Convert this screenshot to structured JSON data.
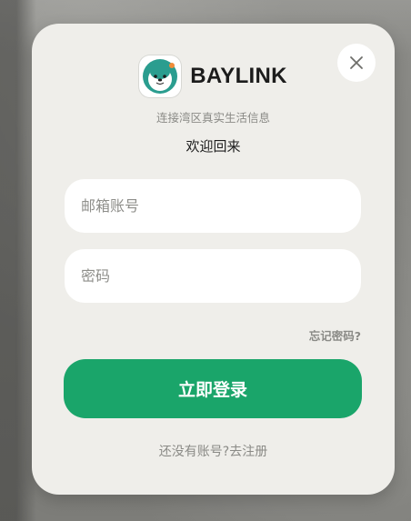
{
  "brand": {
    "name": "BAYLINK",
    "logo_icon": "otter-logo-icon"
  },
  "tagline": "连接湾区真实生活信息",
  "welcome": "欢迎回来",
  "form": {
    "email_placeholder": "邮箱账号",
    "password_placeholder": "密码",
    "forgot_label": "忘记密码?",
    "login_label": "立即登录"
  },
  "register": {
    "prompt": "还没有账号?",
    "link": "去注册"
  },
  "colors": {
    "accent": "#1aa56a",
    "modal_bg": "#efeeea",
    "muted_text": "#8a8a86"
  },
  "close_icon": "close-icon"
}
